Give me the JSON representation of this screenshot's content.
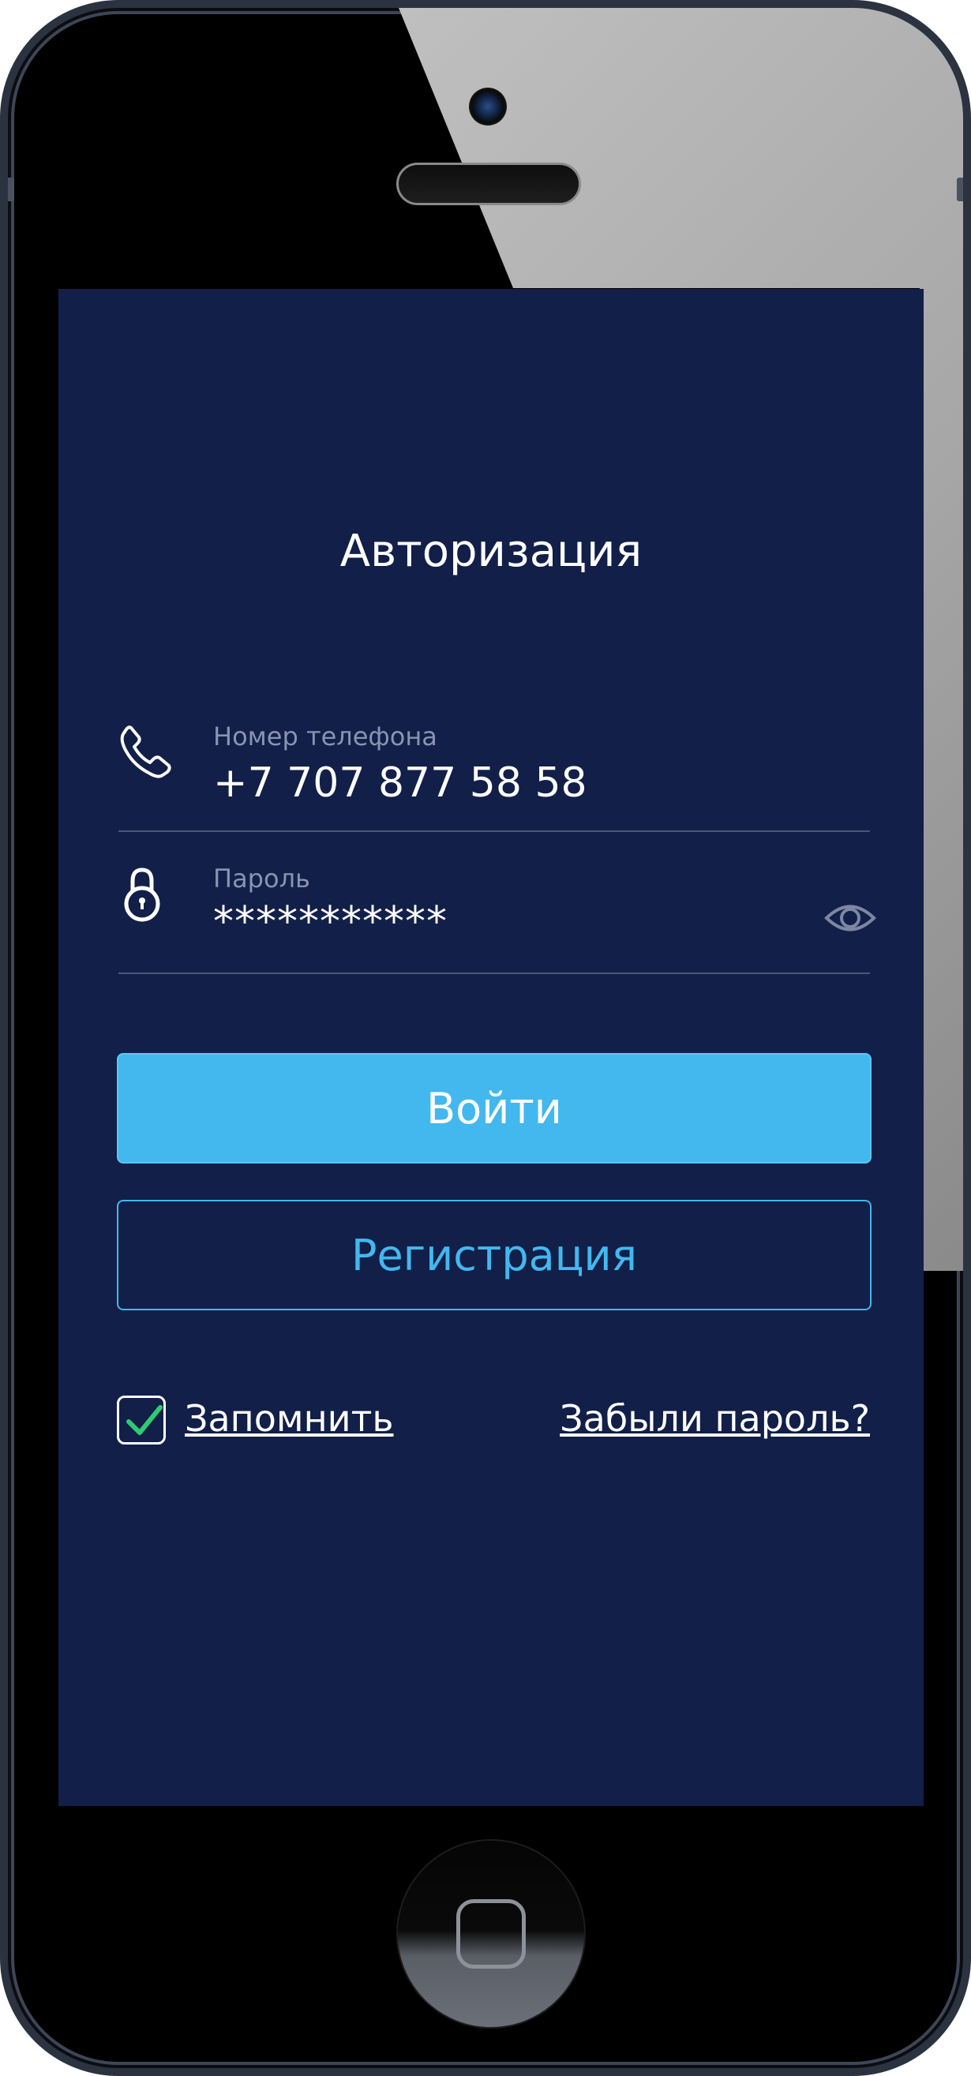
{
  "screen": {
    "title": "Авторизация",
    "phone_field": {
      "label": "Номер телефона",
      "value": "+7 707 877 58 58",
      "icon": "phone-icon"
    },
    "password_field": {
      "label": "Пароль",
      "value": "***********",
      "icon": "lock-icon",
      "toggle_icon": "eye-icon"
    },
    "login_button": "Войти",
    "register_button": "Регистрация",
    "remember": {
      "label": "Запомнить",
      "checked": true
    },
    "forgot_link": "Забыли пароль?"
  },
  "colors": {
    "screen_bg": "#121f48",
    "accent": "#42b8ee",
    "checkmark": "#2ecc71",
    "muted_text": "#8a93b1"
  }
}
